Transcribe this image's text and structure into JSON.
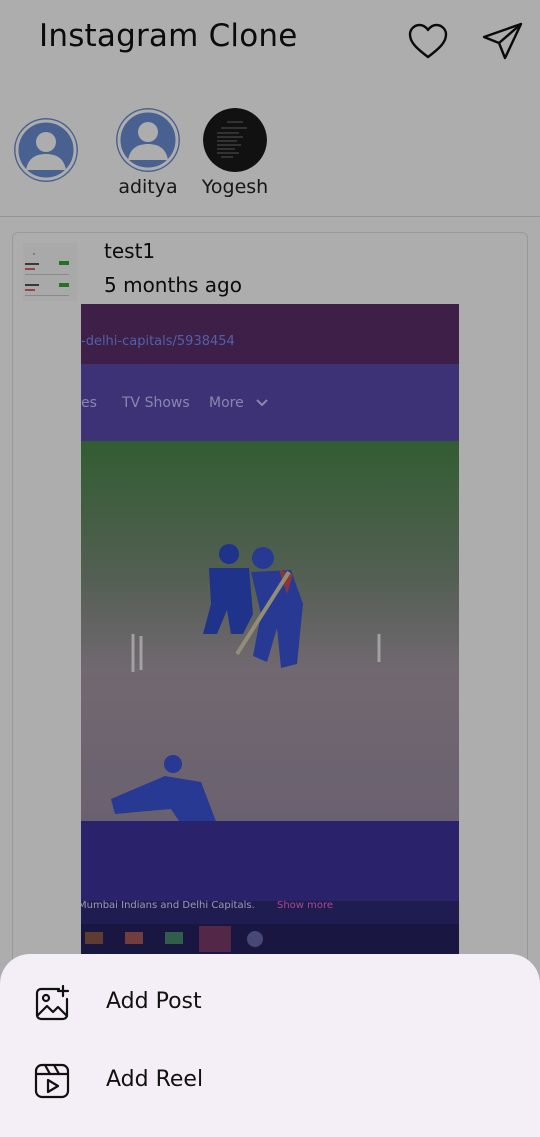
{
  "header": {
    "title": "Instagram Clone",
    "icons": {
      "likes": "heart-icon",
      "messages": "send-icon"
    }
  },
  "stories": [
    {
      "name": "",
      "avatar": "default-avatar"
    },
    {
      "name": "aditya",
      "avatar": "default-avatar"
    },
    {
      "name": "Yogesh",
      "avatar": "photo-avatar"
    }
  ],
  "post": {
    "username": "test1",
    "time": "5 months ago",
    "image_text": {
      "url_fragment": "-delhi-capitals/5938454",
      "nav_items": [
        "es",
        "TV Shows",
        "More"
      ],
      "caption": "Mumbai Indians and Delhi Capitals.",
      "caption_link": "Show more"
    }
  },
  "sheet": {
    "items": [
      {
        "label": "Add Post",
        "icon": "add-image-icon"
      },
      {
        "label": "Add Reel",
        "icon": "reel-icon"
      }
    ]
  },
  "colors": {
    "scrim": "#000000",
    "sheet_bg": "#f4eff7",
    "avatar_bg": "#6b8fd4"
  }
}
